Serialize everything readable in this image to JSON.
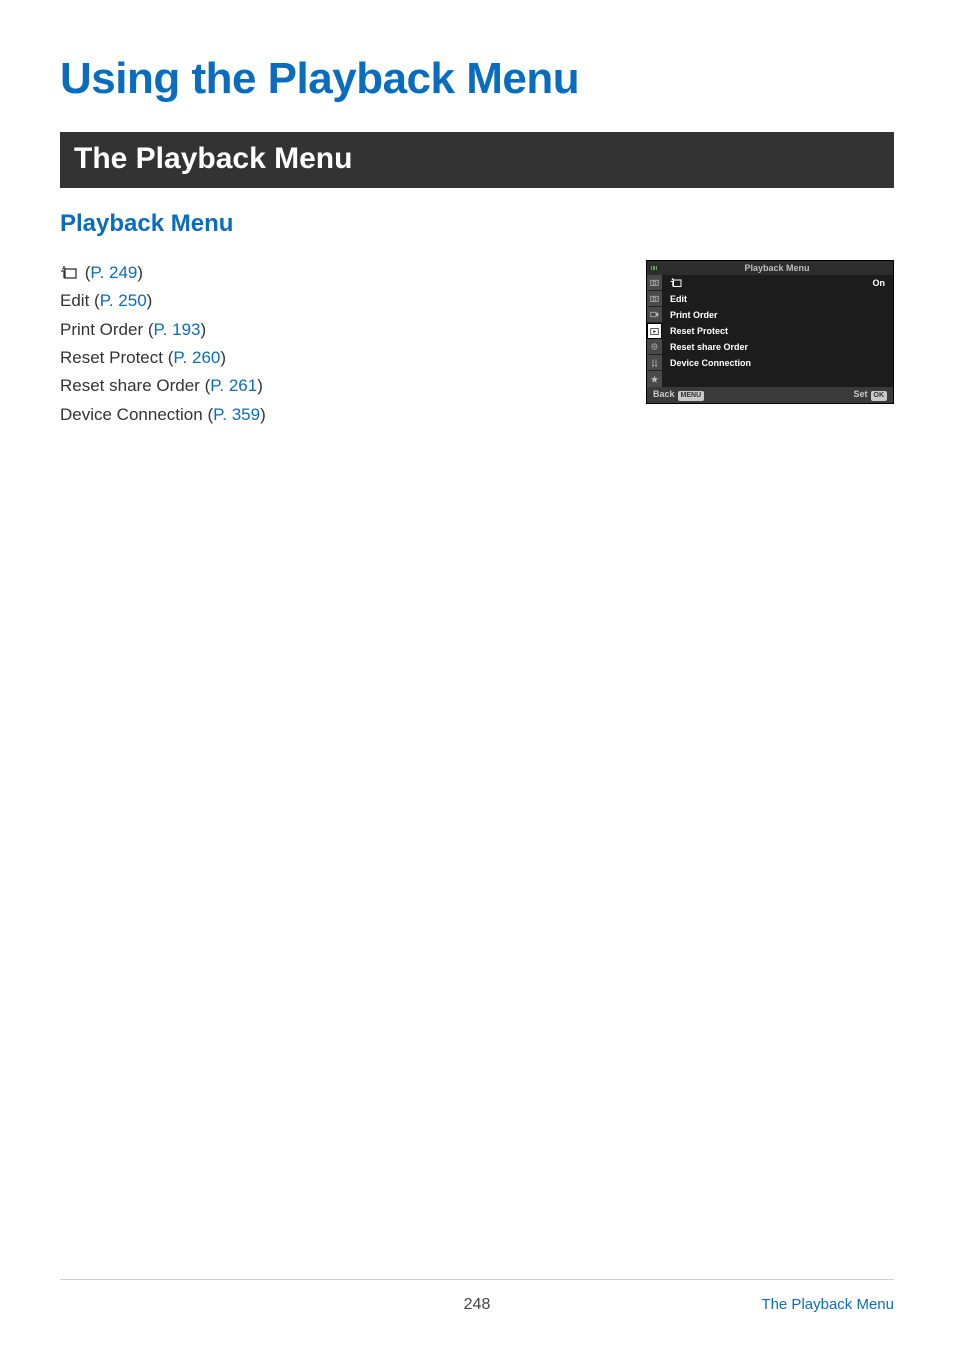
{
  "title": "Using the Playback Menu",
  "section_heading": "The Playback Menu",
  "subheading": "Playback Menu",
  "menu_list": [
    {
      "prefix_icon": "rotate-icon",
      "prefix_text": "",
      "link": "P. 249"
    },
    {
      "prefix_text": "Edit",
      "link": "P. 250"
    },
    {
      "prefix_text": "Print Order",
      "link": "P. 193"
    },
    {
      "prefix_text": "Reset Protect",
      "link": "P. 260"
    },
    {
      "prefix_text": "Reset share Order",
      "link": "P. 261"
    },
    {
      "prefix_text": "Device Connection",
      "link": "P. 359"
    }
  ],
  "panel": {
    "title": "Playback Menu",
    "rows": [
      {
        "icon": "rotate-icon",
        "value": "On"
      },
      {
        "label": "Edit"
      },
      {
        "label": "Print Order"
      },
      {
        "label": "Reset Protect"
      },
      {
        "label": "Reset share Order"
      },
      {
        "label": "Device Connection"
      }
    ],
    "side_tabs": [
      {
        "name": "camera1-icon"
      },
      {
        "name": "camera2-icon"
      },
      {
        "name": "video-icon"
      },
      {
        "name": "play-icon",
        "active": true
      },
      {
        "name": "gear-icon"
      },
      {
        "name": "setup-icon"
      },
      {
        "name": "star-icon"
      }
    ],
    "footer_back": "Back",
    "footer_back_badge": "MENU",
    "footer_set": "Set",
    "footer_set_badge": "OK"
  },
  "footer": {
    "page": "248",
    "link": "The Playback Menu"
  }
}
